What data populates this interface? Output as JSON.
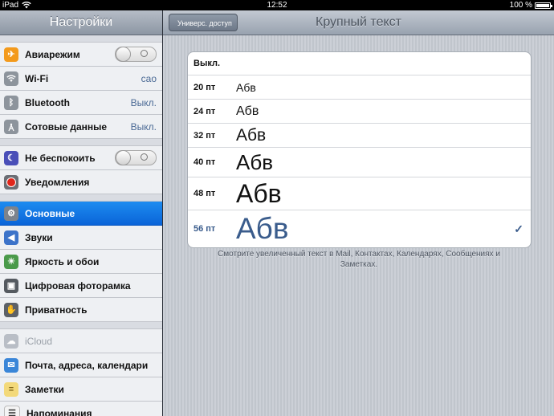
{
  "status_bar": {
    "device": "iPad",
    "time": "12:52",
    "battery": "100 %",
    "battery_level": 1.0
  },
  "sidebar": {
    "title": "Настройки",
    "groups": [
      [
        {
          "label": "Авиарежим",
          "icon": "airplane-icon",
          "control": "toggle-off"
        },
        {
          "label": "Wi-Fi",
          "icon": "wifi-icon",
          "value": "cao"
        },
        {
          "label": "Bluetooth",
          "icon": "bluetooth-icon",
          "value": "Выкл."
        },
        {
          "label": "Сотовые данные",
          "icon": "cellular-icon",
          "value": "Выкл."
        }
      ],
      [
        {
          "label": "Не беспокоить",
          "icon": "moon-icon",
          "control": "toggle-off"
        },
        {
          "label": "Уведомления",
          "icon": "notifications-icon"
        }
      ],
      [
        {
          "label": "Основные",
          "icon": "gear-icon",
          "selected": true
        },
        {
          "label": "Звуки",
          "icon": "speaker-icon"
        },
        {
          "label": "Яркость и обои",
          "icon": "brightness-icon"
        },
        {
          "label": "Цифровая фоторамка",
          "icon": "photo-frame-icon"
        },
        {
          "label": "Приватность",
          "icon": "hand-icon"
        }
      ],
      [
        {
          "label": "iCloud",
          "icon": "cloud-icon",
          "disabled": true
        },
        {
          "label": "Почта, адреса, календари",
          "icon": "mail-icon"
        },
        {
          "label": "Заметки",
          "icon": "notes-icon"
        },
        {
          "label": "Напоминания",
          "icon": "reminders-icon"
        }
      ]
    ]
  },
  "main": {
    "back_label": "Универс. доступ",
    "title": "Крупный текст",
    "options": [
      {
        "label": "Выкл.",
        "sample": ""
      },
      {
        "label": "20 пт",
        "sample": "Абв",
        "pt": 20
      },
      {
        "label": "24 пт",
        "sample": "Абв",
        "pt": 24
      },
      {
        "label": "32 пт",
        "sample": "Абв",
        "pt": 32
      },
      {
        "label": "40 пт",
        "sample": "Абв",
        "pt": 40
      },
      {
        "label": "48 пт",
        "sample": "Абв",
        "pt": 48
      },
      {
        "label": "56 пт",
        "sample": "Абв",
        "pt": 56,
        "selected": true
      }
    ],
    "checkmark": "✓",
    "footnote": "Смотрите увеличенный текст в Mail, Контактах, Календарях, Сообщениях и Заметках."
  },
  "colors": {
    "selected_row": "#0a64d8",
    "detail_text": "#4b6a95",
    "selected_option": "#3a5c8c"
  }
}
